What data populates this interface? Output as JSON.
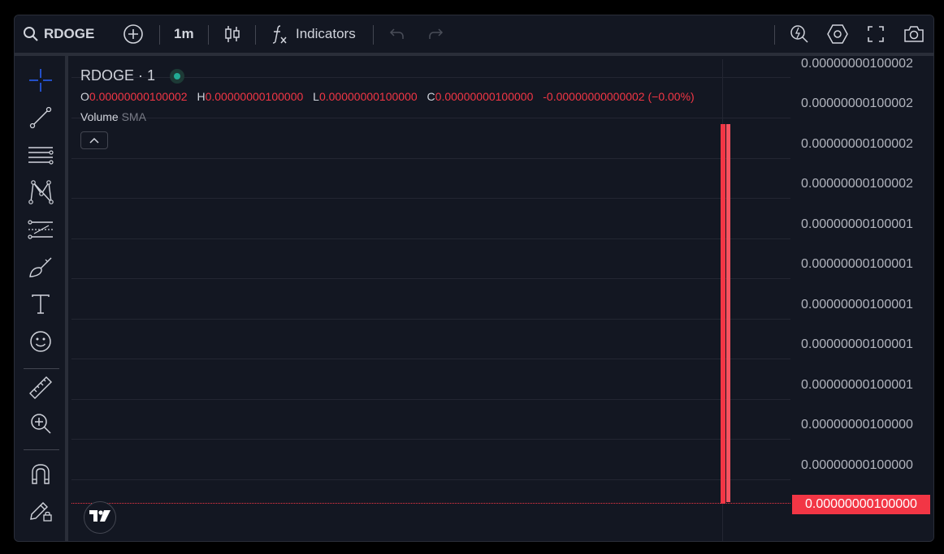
{
  "toolbar": {
    "symbol": "RDOGE",
    "interval": "1m",
    "indicators_label": "Indicators"
  },
  "legend": {
    "title": "RDOGE · 1",
    "o_key": "O",
    "o_val": "0.00000000100002",
    "h_key": "H",
    "h_val": "0.00000000100000",
    "l_key": "L",
    "l_val": "0.00000000100000",
    "c_key": "C",
    "c_val": "0.00000000100000",
    "change": "-0.00000000000002 (−0.00%)",
    "volume_label": "Volume",
    "volume_ma": "SMA"
  },
  "price_axis": {
    "ticks": [
      "0.00000000100002",
      "0.00000000100002",
      "0.00000000100002",
      "0.00000000100002",
      "0.00000000100001",
      "0.00000000100001",
      "0.00000000100001",
      "0.00000000100001",
      "0.00000000100001",
      "0.00000000100000",
      "0.00000000100000"
    ],
    "last_price": "0.00000000100000"
  },
  "colors": {
    "background": "#131722",
    "down": "#f23645",
    "live_dot": "#22ab94"
  }
}
